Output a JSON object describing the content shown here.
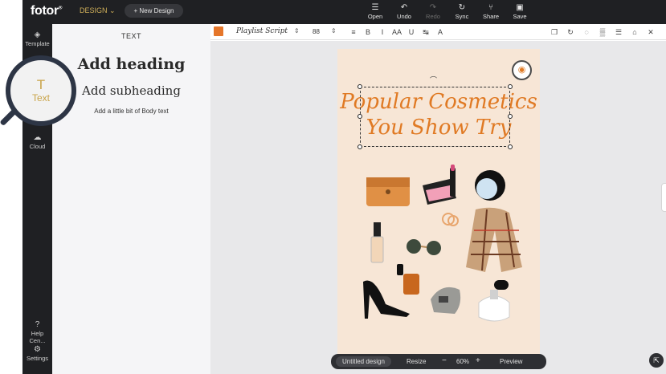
{
  "topbar": {
    "logo": "fotor",
    "design_menu": "DESIGN",
    "new_design": "+ New Design",
    "actions": [
      {
        "label": "Open",
        "icon": "menu-icon",
        "glyph": "☰",
        "enabled": true
      },
      {
        "label": "Undo",
        "icon": "undo-icon",
        "glyph": "↶",
        "enabled": true
      },
      {
        "label": "Redo",
        "icon": "redo-icon",
        "glyph": "↷",
        "enabled": false
      },
      {
        "label": "Sync",
        "icon": "sync-icon",
        "glyph": "↻",
        "enabled": true
      },
      {
        "label": "Share",
        "icon": "share-icon",
        "glyph": "⑂",
        "enabled": true
      },
      {
        "label": "Save",
        "icon": "save-icon",
        "glyph": "▣",
        "enabled": true
      }
    ]
  },
  "rail": {
    "items": [
      {
        "label": "Template",
        "icon": "template-icon",
        "glyph": "◈"
      },
      {
        "label": "Cloud",
        "icon": "cloud-upload-icon",
        "glyph": "☁"
      },
      {
        "label": "Help Cen...",
        "icon": "help-icon",
        "glyph": "?"
      },
      {
        "label": "Settings",
        "icon": "gear-icon",
        "glyph": "⚙"
      }
    ],
    "active": {
      "label": "Text",
      "icon": "text-icon",
      "glyph": "T"
    }
  },
  "panel": {
    "title": "TEXT",
    "add_heading": "Add heading",
    "add_subheading": "Add subheading",
    "add_body": "Add a little bit of Body text"
  },
  "format_bar": {
    "text_color": "#e5762a",
    "font_name": "Playlist Script",
    "font_size": "88",
    "tools": [
      {
        "name": "align-icon",
        "glyph": "≡"
      },
      {
        "name": "bold-icon",
        "glyph": "B"
      },
      {
        "name": "italic-icon",
        "glyph": "I"
      },
      {
        "name": "case-icon",
        "glyph": "AA"
      },
      {
        "name": "underline-icon",
        "glyph": "U"
      },
      {
        "name": "spacing-icon",
        "glyph": "↹"
      },
      {
        "name": "text-effect-icon",
        "glyph": "A"
      }
    ],
    "right_tools": [
      {
        "name": "duplicate-icon",
        "glyph": "❐"
      },
      {
        "name": "flip-icon",
        "glyph": "↻"
      },
      {
        "name": "crop-icon",
        "glyph": "◌"
      },
      {
        "name": "transparency-icon",
        "glyph": "▒"
      },
      {
        "name": "layers-icon",
        "glyph": "☰"
      },
      {
        "name": "lock-icon",
        "glyph": "⌂"
      },
      {
        "name": "delete-icon",
        "glyph": "✕"
      }
    ]
  },
  "poster": {
    "title_line1": "Popular Cosmetics",
    "title_line2": "You Show Try",
    "background": "#f7e6d6",
    "title_color": "#e07a24"
  },
  "bottom_bar": {
    "design_name": "Untitled design",
    "resize": "Resize",
    "zoom": "60%",
    "preview": "Preview"
  }
}
